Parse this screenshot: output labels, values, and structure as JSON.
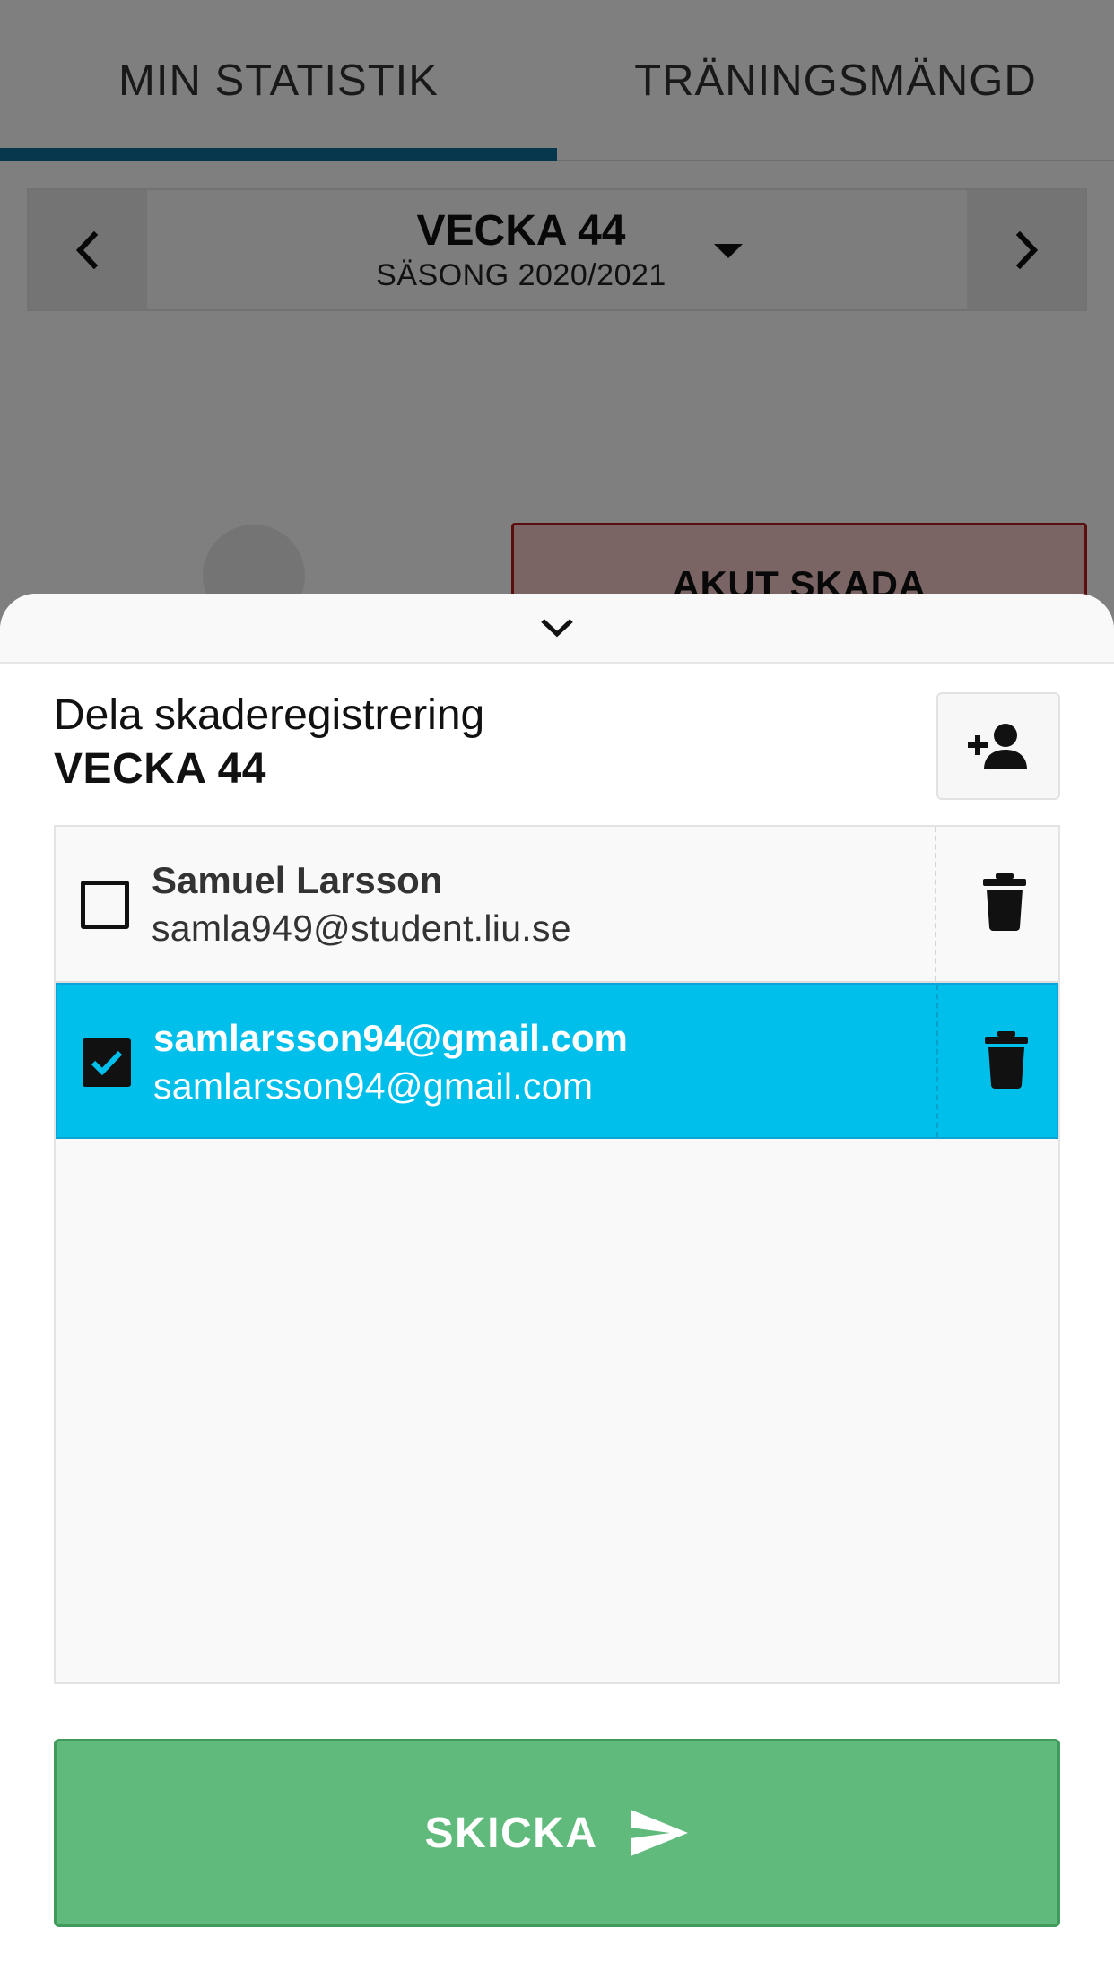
{
  "tabs": [
    {
      "label": "MIN STATISTIK",
      "active": true
    },
    {
      "label": "TRÄNINGSMÄNGD",
      "active": false
    }
  ],
  "week_selector": {
    "week": "VECKA 44",
    "season": "SÄSONG 2020/2021"
  },
  "background": {
    "akut_label": "AKUT SKADA"
  },
  "sheet": {
    "title": "Dela skaderegistrering",
    "week": "VECKA 44",
    "recipients": [
      {
        "name": "Samuel Larsson",
        "email": "samla949@student.liu.se",
        "checked": false
      },
      {
        "name": "samlarsson94@gmail.com",
        "email": "samlarsson94@gmail.com",
        "checked": true
      }
    ],
    "send_label": "SKICKA"
  },
  "colors": {
    "tab_indicator": "#0d6e99",
    "selected_row": "#00bfea",
    "send_button": "#5fba7c",
    "akut_border": "#b71c1c"
  },
  "icons": [
    "chevron-left-icon",
    "chevron-right-icon",
    "caret-down-icon",
    "chevron-down-icon",
    "add-person-icon",
    "trash-icon",
    "send-icon",
    "check-icon"
  ]
}
